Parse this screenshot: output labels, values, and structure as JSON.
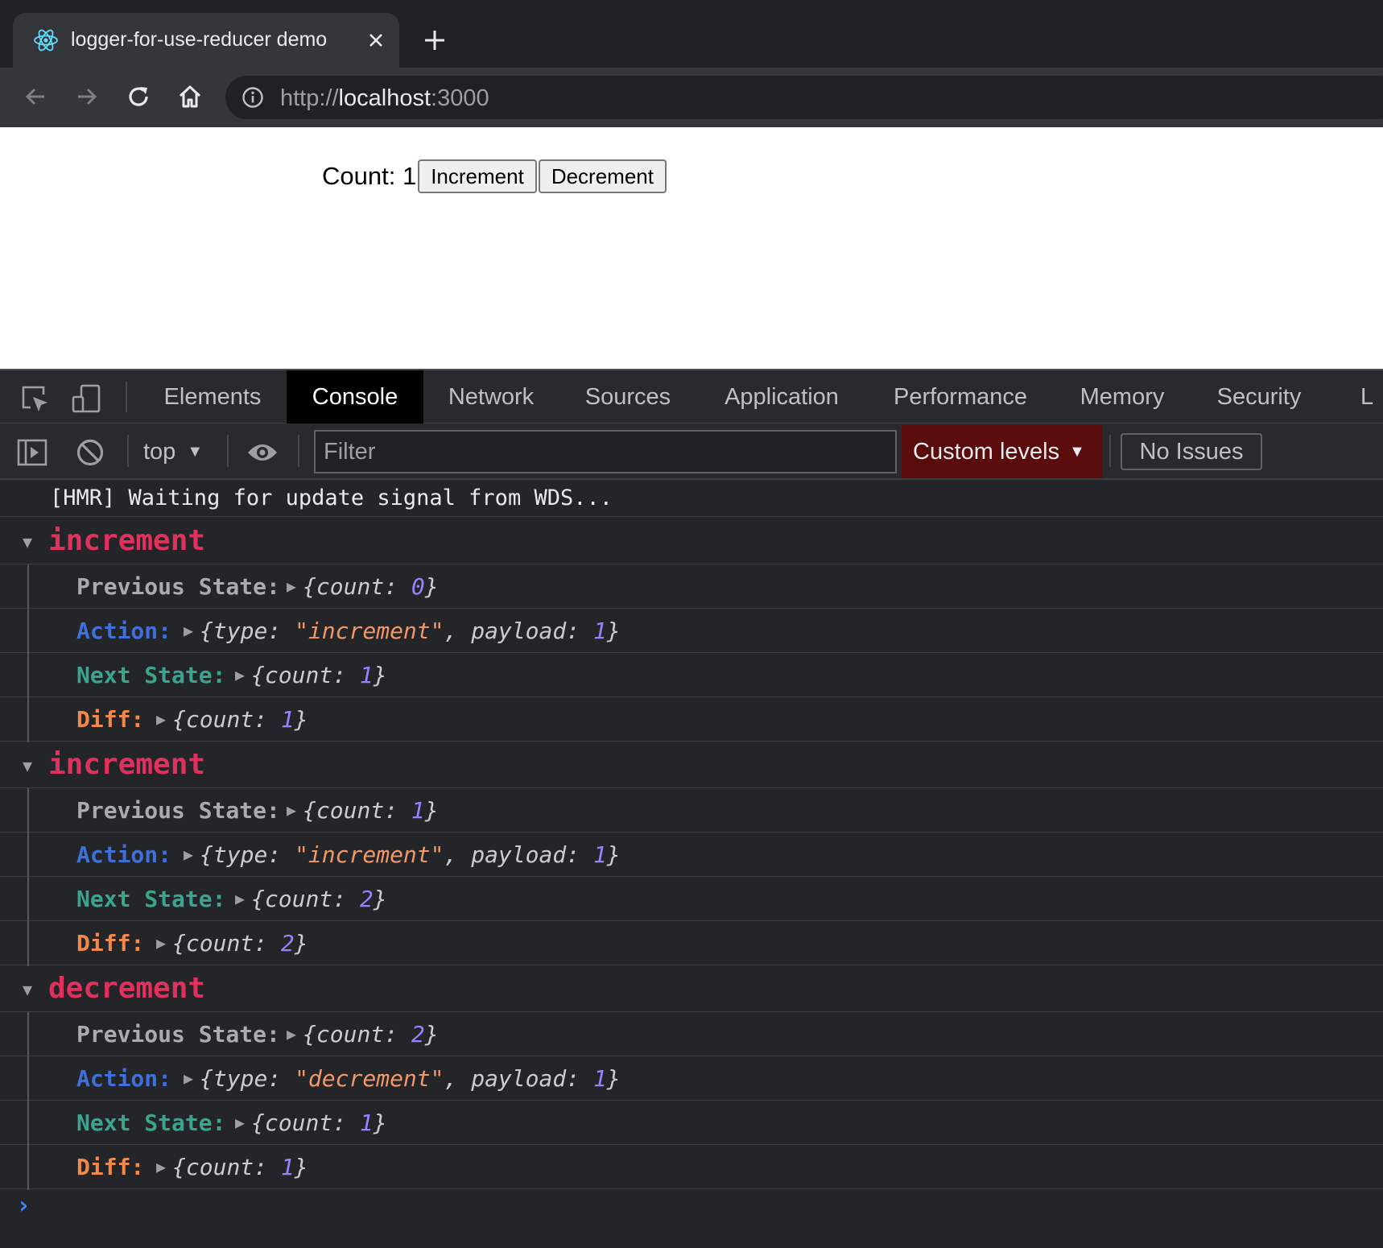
{
  "browser": {
    "tab_title": "logger-for-use-reducer demo",
    "url_scheme": "http://",
    "url_host": "localhost",
    "url_port": ":3000"
  },
  "page": {
    "count_label": "Count: 1",
    "increment_label": "Increment",
    "decrement_label": "Decrement"
  },
  "devtools": {
    "tabs": [
      "Elements",
      "Console",
      "Network",
      "Sources",
      "Application",
      "Performance",
      "Memory",
      "Security",
      "L"
    ],
    "active_tab": "Console",
    "context": "top",
    "filter_placeholder": "Filter",
    "levels_label": "Custom levels",
    "issues_label": "No Issues"
  },
  "console": {
    "hmr_message": "[HMR] Waiting for update signal from WDS...",
    "keys": {
      "prev": "Previous State:",
      "action": "Action:",
      "next": "Next State:",
      "diff": "Diff:"
    },
    "groups": [
      {
        "name": "increment",
        "prev_count": "0",
        "action_type": "\"increment\"",
        "action_payload": "1",
        "next_count": "1",
        "diff_count": "1"
      },
      {
        "name": "increment",
        "prev_count": "1",
        "action_type": "\"increment\"",
        "action_payload": "1",
        "next_count": "2",
        "diff_count": "2"
      },
      {
        "name": "decrement",
        "prev_count": "2",
        "action_type": "\"decrement\"",
        "action_payload": "1",
        "next_count": "1",
        "diff_count": "1"
      }
    ],
    "prompt": "›"
  },
  "colors": {
    "group_name": "#e0315c",
    "prev_key": "#a8abb0",
    "action_key": "#3f6fd8",
    "next_key": "#3aa58f",
    "diff_key": "#f08a4b",
    "number": "#9980ff",
    "string": "#f29766",
    "levels_bg": "#5a0c0c"
  }
}
